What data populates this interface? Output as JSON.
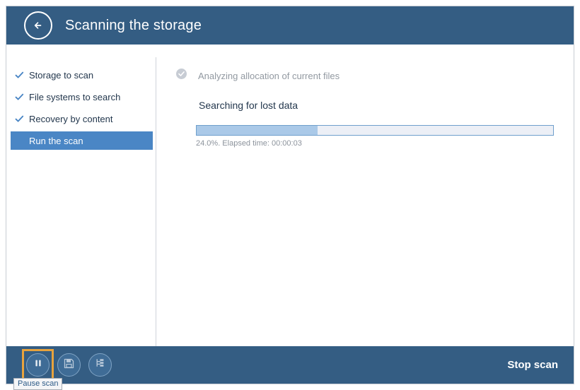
{
  "header": {
    "title": "Scanning the storage",
    "back_icon": "arrow-left-icon"
  },
  "sidebar": {
    "items": [
      {
        "label": "Storage to scan",
        "state": "completed",
        "icon": "check-icon"
      },
      {
        "label": "File systems to search",
        "state": "completed",
        "icon": "check-icon"
      },
      {
        "label": "Recovery by content",
        "state": "completed",
        "icon": "check-icon"
      },
      {
        "label": "Run the scan",
        "state": "active",
        "icon": ""
      }
    ]
  },
  "main": {
    "completed_task": {
      "label": "Analyzing allocation of current files",
      "icon": "check-circle-icon"
    },
    "current_task": "Searching for lost data",
    "progress": {
      "percent": 24.0,
      "fill_percent": 34,
      "status": "24.0%. Elapsed time: 00:00:03"
    }
  },
  "footer": {
    "buttons": [
      {
        "name": "pause-scan-button",
        "icon": "pause-icon",
        "focused": true
      },
      {
        "name": "save-button",
        "icon": "floppy-disk-icon",
        "focused": false
      },
      {
        "name": "tree-view-button",
        "icon": "tree-hierarchy-icon",
        "focused": false
      }
    ],
    "stop_label": "Stop scan"
  },
  "tooltip": {
    "text": "Pause scan"
  },
  "colors": {
    "header_blue": "#345d83",
    "accent_blue": "#4a86c5",
    "progress_fill": "#aac9e8",
    "focus_orange": "#e8a33d"
  }
}
